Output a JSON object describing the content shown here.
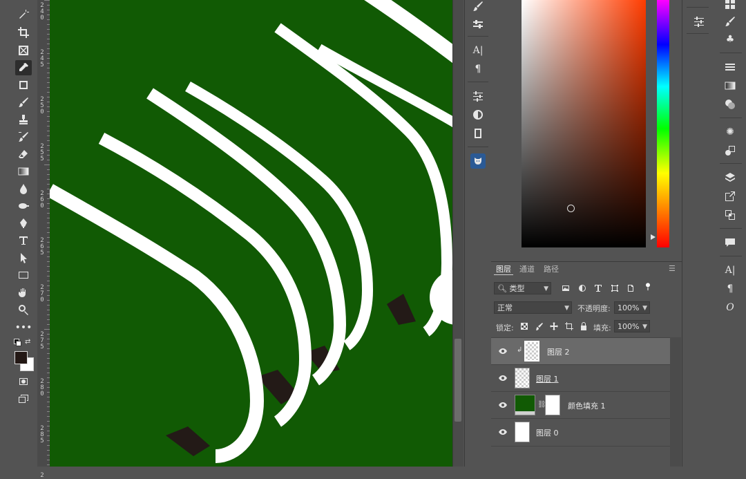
{
  "ruler": {
    "labels": [
      "2\n4\n0",
      "2\n4\n5",
      "2\n5\n0",
      "2\n5\n5",
      "2\n6\n0",
      "2\n6\n5",
      "2\n7\n0",
      "2\n7\n5",
      "2\n8\n0",
      "2\n8\n5",
      "2"
    ]
  },
  "panels": {
    "layers_tab": "图层",
    "channels_tab": "通道",
    "paths_tab": "路径",
    "filter_kind": "类型",
    "blend_mode": "正常",
    "opacity_label": "不透明度:",
    "opacity_value": "100%",
    "lock_label": "锁定:",
    "fill_label": "填充:",
    "fill_value": "100%"
  },
  "layers": [
    {
      "name": "图层 2"
    },
    {
      "name": "图层 1"
    },
    {
      "name": "颜色填充 1"
    },
    {
      "name": "图层 0"
    }
  ],
  "colors": {
    "canvas_bg": "#115a04",
    "stroke": "#ffffff",
    "shadow": "#231a17",
    "fg_swatch": "#231815",
    "bg_swatch": "#ffffff"
  }
}
